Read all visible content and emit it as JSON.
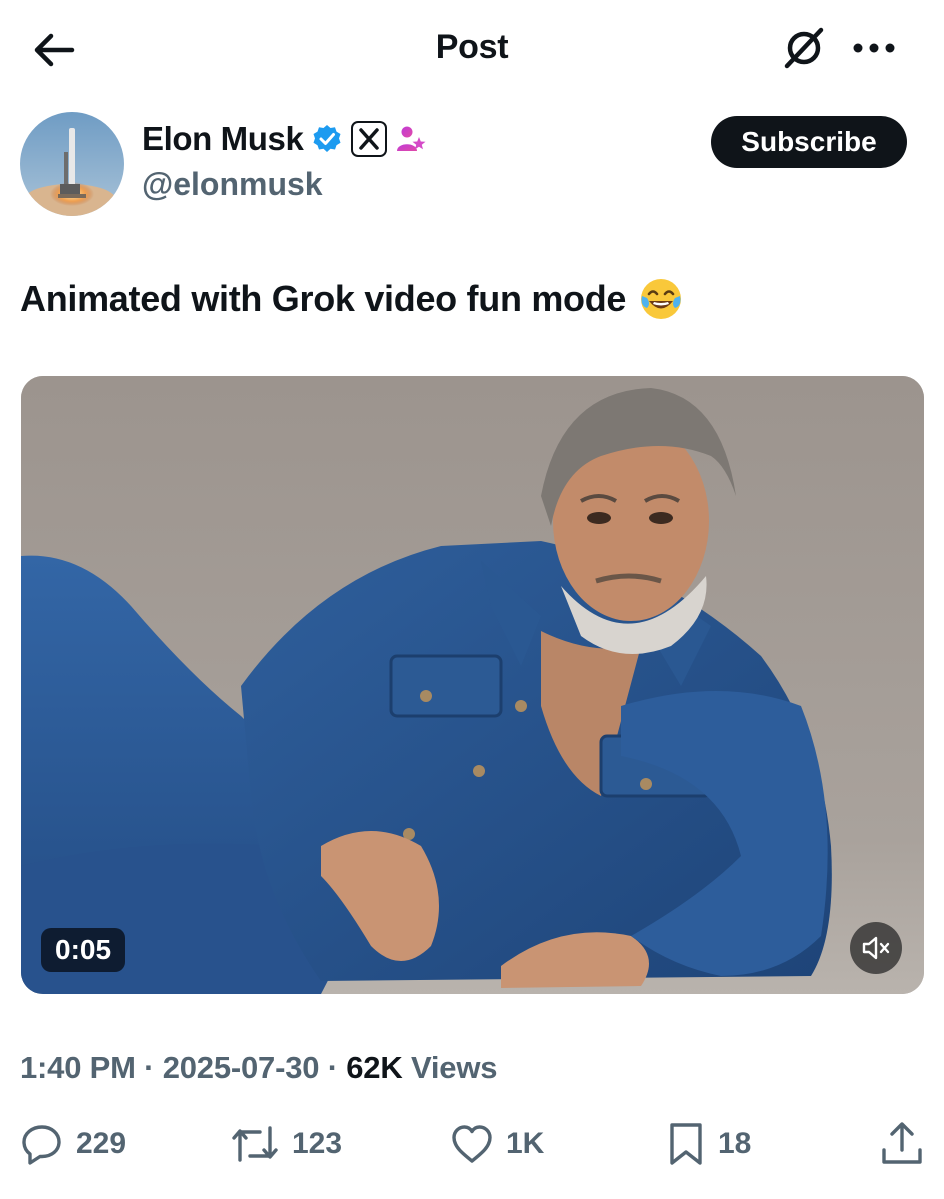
{
  "header": {
    "title": "Post",
    "back_icon": "arrow-left-icon",
    "grok_icon": "grok-icon",
    "more_icon": "more-horizontal-icon"
  },
  "author": {
    "display_name": "Elon Musk",
    "handle": "@elonmusk",
    "badges": [
      "verified-badge-icon",
      "x-affiliate-badge-icon",
      "subscriber-badge-icon"
    ],
    "subscribe_label": "Subscribe"
  },
  "post": {
    "text": "Animated with Grok video fun mode",
    "emoji": "face-with-tears-of-joy-emoji"
  },
  "media": {
    "type": "video",
    "duration": "0:05",
    "mute_icon": "volume-muted-icon"
  },
  "meta": {
    "time": "1:40 PM",
    "separator": " · ",
    "date": "2025-07-30",
    "views_count": "62K",
    "views_label": " Views"
  },
  "actions": {
    "replies": "229",
    "reposts": "123",
    "likes": "1K",
    "bookmarks": "18"
  },
  "colors": {
    "text_primary": "#0f1419",
    "text_secondary": "#536471",
    "verified_blue": "#1d9bf0",
    "subscribe_bg": "#0f1419"
  }
}
